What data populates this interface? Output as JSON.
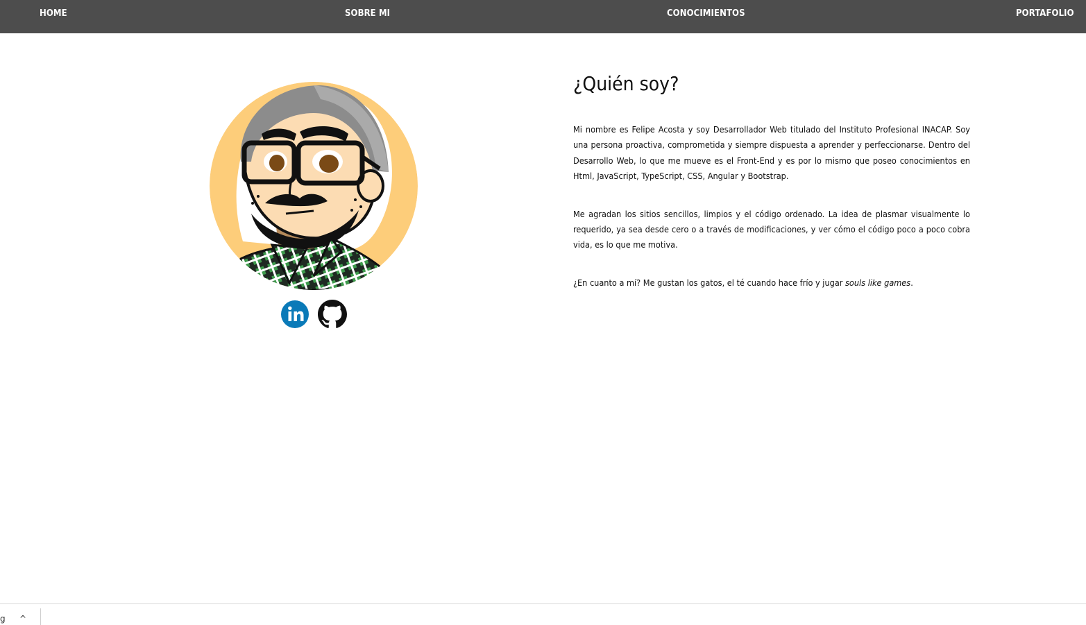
{
  "nav": {
    "home": "HOME",
    "about": "SOBRE MI",
    "skills": "CONOCIMIENTOS",
    "portfolio": "PORTAFOLIO"
  },
  "about": {
    "title": "¿Quién soy?",
    "p1": "Mi nombre es Felipe Acosta y soy Desarrollador Web titulado del Instituto Profesional INACAP. Soy una persona proactiva, comprometida y siempre dispuesta a aprender y perfeccionarse. Dentro del Desarrollo Web, lo que me mueve es el Front-End y es por lo mismo que poseo conocimientos en Html, JavaScript, TypeScript, CSS, Angular y Bootstrap.",
    "p2": "Me agradan los sitios sencillos, limpios y el código ordenado. La idea de plasmar visualmente lo requerido, ya sea desde cero o a través de modificaciones, y ver cómo el código poco a poco cobra vida, es lo que me motiva.",
    "p3_text": "¿En cuanto a mí? Me gustan los gatos, el té cuando hace frío y jugar ",
    "p3_emph": "souls like games",
    "p3_end": "."
  },
  "social": {
    "linkedin_icon": "linkedin-icon",
    "github_icon": "github-icon"
  },
  "footer": {
    "left_glyph": "g",
    "caret": "^"
  },
  "colors": {
    "navbar": "#4d4d4d",
    "nav_text": "#ffffff",
    "avatar_bg": "#fdcd7a",
    "linkedin": "#0a7ab8",
    "text": "#111111"
  }
}
